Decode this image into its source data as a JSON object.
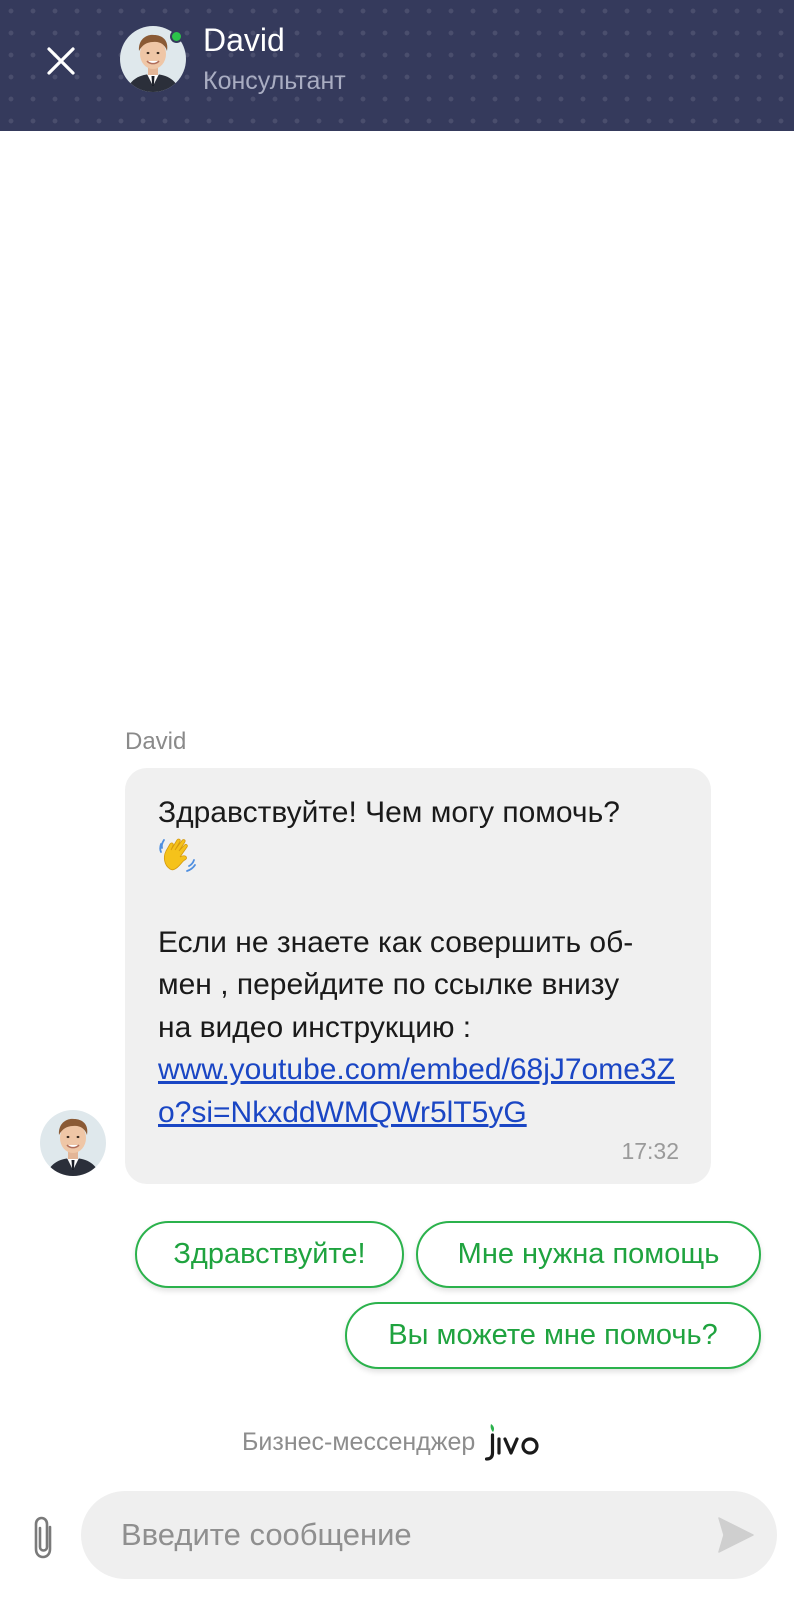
{
  "header": {
    "agent_name": "David",
    "agent_role": "Консультант",
    "status": "online",
    "icons": {
      "close": "close-icon",
      "status": "online-status-dot"
    }
  },
  "conversation": {
    "messages": [
      {
        "sender": "David",
        "greeting": "Здравствуйте! Чем могу помочь?",
        "emoji": "waving-hand",
        "body_line1": "Если не знаете как совершить об-",
        "body_line2": "мен , перейдите по ссылке внизу",
        "body_line3": "на видео инструкцию :",
        "link": "www.youtube.com/embed/68jJ7ome3Zo?si=NkxddWMQWr5lT5yG",
        "time": "17:32"
      }
    ]
  },
  "quick_replies": [
    "Здравствуйте!",
    "Мне нужна помощь",
    "Вы можете мне помочь?"
  ],
  "branding": {
    "text": "Бизнес-мессенджер",
    "logo": "jivo"
  },
  "composer": {
    "placeholder": "Введите сообщение",
    "icons": {
      "attach": "paperclip-icon",
      "send": "send-icon"
    }
  },
  "colors": {
    "header_bg": "#353a5c",
    "accent_green": "#2bb24c",
    "bubble_bg": "#f0f0f0",
    "link": "#1a46c4"
  }
}
